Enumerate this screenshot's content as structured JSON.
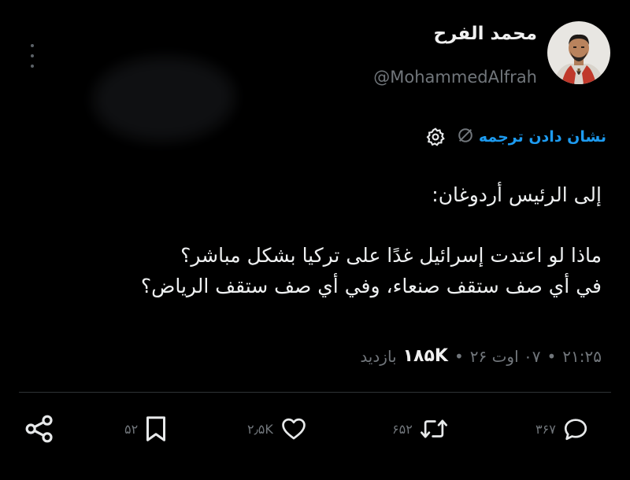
{
  "author": {
    "display_name": "محمد الفرح",
    "handle": "@MohammedAlfrah"
  },
  "translate": {
    "label": "نشان دادن ترجمه"
  },
  "tweet": {
    "line1": "إلى الرئيس أردوغان:",
    "line2": "ماذا لو اعتدت إسرائيل غدًا على تركيا بشكل مباشر؟",
    "line3": "في أي صف ستقف صنعاء، وفي أي صف ستقف الرياض؟"
  },
  "meta": {
    "time": "۲۱:۲۵",
    "date": "۰۷ اوت ۲۶",
    "views": "۱۸۵K",
    "views_label": "بازدید",
    "separator": "•"
  },
  "actions": {
    "replies": "۳۶۷",
    "retweets": "۶۵۲",
    "likes": "۲٫۵K",
    "bookmarks": "۵۲"
  },
  "icons": {
    "more": "more-vertical-icon",
    "translate": "translate-globe-icon",
    "settings": "gear-icon",
    "reply": "reply-bubble-icon",
    "retweet": "retweet-icon",
    "like": "heart-icon",
    "bookmark": "bookmark-icon",
    "share": "share-nodes-icon"
  },
  "colors": {
    "background": "#000000",
    "text": "#e7e9ea",
    "muted": "#71767b",
    "accent": "#1d9bf0"
  }
}
